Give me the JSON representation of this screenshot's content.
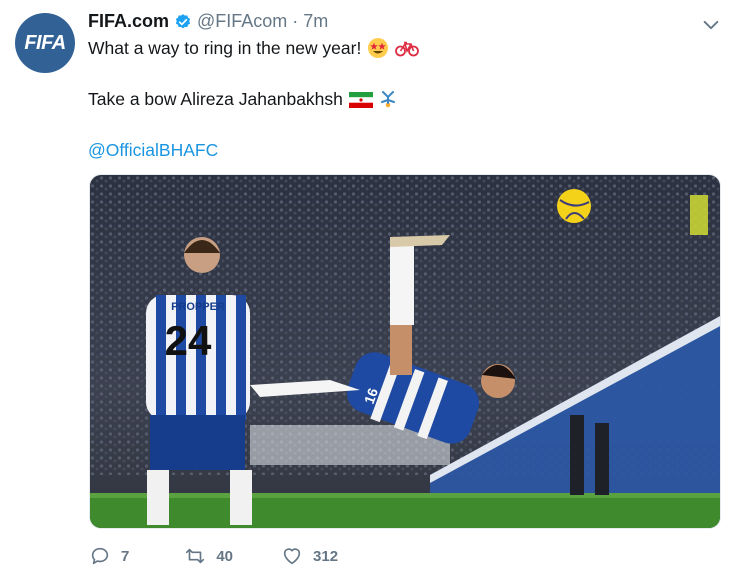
{
  "tweet": {
    "author_name": "FIFA.com",
    "author_handle": "@FIFAcom",
    "separator": "·",
    "time": "7m",
    "avatar_text": "FIFA",
    "line1": "What a way to ring in the new year!",
    "line2": "Take a bow Alireza Jahanbakhsh",
    "mention": "@OfficialBHAFC",
    "line1_emojis": [
      "star-struck-emoji",
      "bicycle-emoji"
    ],
    "line2_emojis": [
      "iran-flag-emoji",
      "cartwheel-emoji"
    ]
  },
  "media": {
    "player_number": "24",
    "player_name": "PROPPER",
    "kicker_number": "16"
  },
  "actions": {
    "replies": "7",
    "retweets": "40",
    "likes": "312"
  },
  "colors": {
    "avatar_bg": "#326295",
    "link": "#1b95e0",
    "muted": "#657786",
    "verified": "#1da1f2"
  }
}
